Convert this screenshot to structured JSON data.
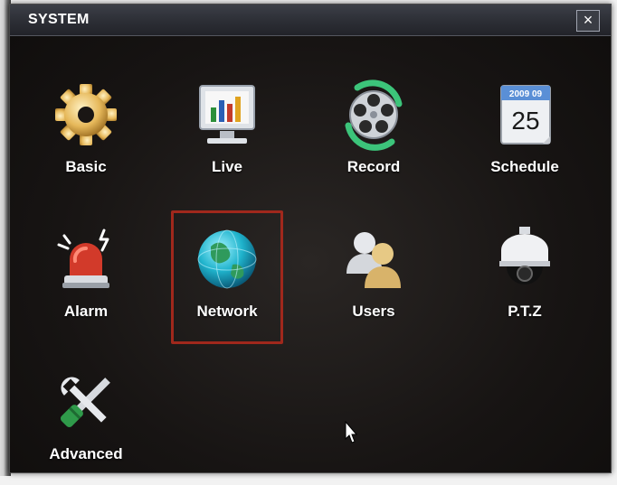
{
  "window": {
    "title": "SYSTEM",
    "close_label": "×"
  },
  "menu": {
    "items": [
      {
        "label": "Basic",
        "icon": "gear-icon"
      },
      {
        "label": "Live",
        "icon": "monitor-icon"
      },
      {
        "label": "Record",
        "icon": "film-reel-icon"
      },
      {
        "label": "Schedule",
        "icon": "calendar-icon",
        "calendar_top": "2009 09",
        "calendar_day": "25"
      },
      {
        "label": "Alarm",
        "icon": "siren-icon"
      },
      {
        "label": "Network",
        "icon": "globe-icon",
        "selected": true
      },
      {
        "label": "Users",
        "icon": "users-icon"
      },
      {
        "label": "P.T.Z",
        "icon": "dome-camera-icon"
      },
      {
        "label": "Advanced",
        "icon": "tools-icon"
      }
    ]
  },
  "colors": {
    "selection_border": "#a0281c",
    "background": "#171413",
    "text": "#ffffff"
  }
}
